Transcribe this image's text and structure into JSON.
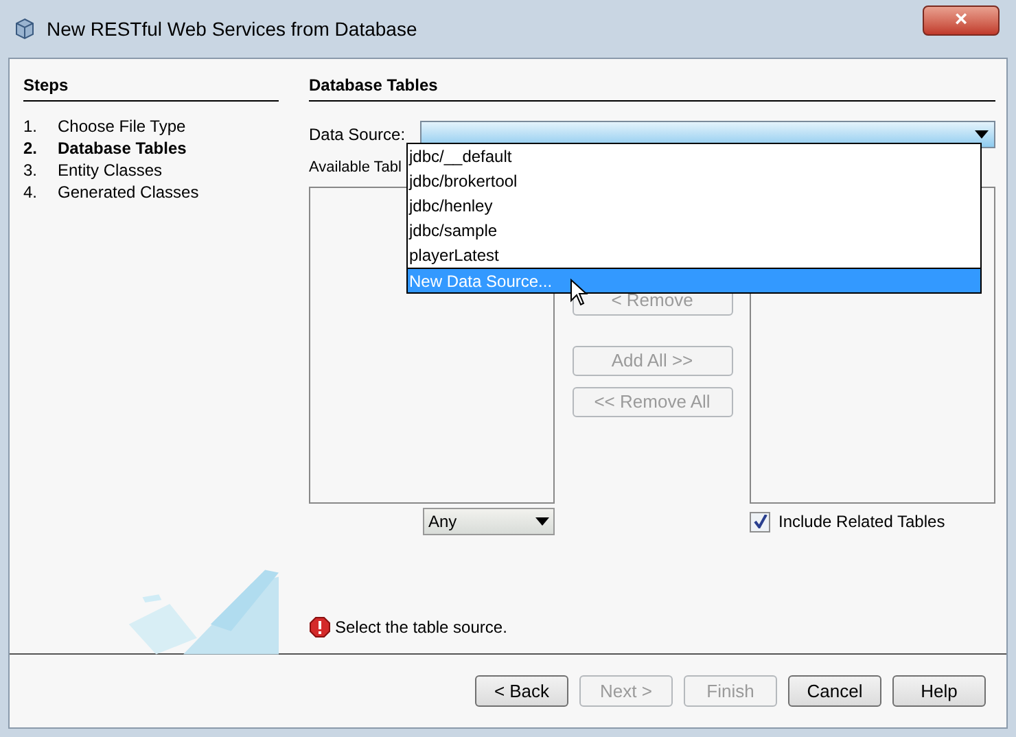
{
  "window": {
    "title": "New RESTful Web Services from Database",
    "close": "×"
  },
  "steps": {
    "title": "Steps",
    "items": [
      {
        "number": "1.",
        "label": "Choose File Type",
        "selected": false
      },
      {
        "number": "2.",
        "label": "Database Tables",
        "selected": true
      },
      {
        "number": "3.",
        "label": "Entity Classes",
        "selected": false
      },
      {
        "number": "4.",
        "label": "Generated Classes",
        "selected": false
      }
    ]
  },
  "panel": {
    "title": "Database Tables",
    "data_source_label": "Data Source:",
    "available_label": "Available Tabl",
    "data_source_options": [
      {
        "label": "jdbc/__default",
        "selected": false
      },
      {
        "label": "jdbc/brokertool",
        "selected": false
      },
      {
        "label": "jdbc/henley",
        "selected": false
      },
      {
        "label": "jdbc/sample",
        "selected": false
      },
      {
        "label": "playerLatest",
        "selected": false
      },
      {
        "label": "New Data Source...",
        "selected": true
      }
    ],
    "middle_buttons": [
      {
        "label": "< Remove",
        "disabled": true
      },
      {
        "label": "Add All >>",
        "disabled": true
      },
      {
        "label": "<< Remove All",
        "disabled": true
      }
    ],
    "filter": {
      "value": "Any"
    },
    "include_related": {
      "label": "Include Related Tables",
      "checked": true
    },
    "message": "Select the table source."
  },
  "buttons": [
    {
      "label": "< Back",
      "disabled": false
    },
    {
      "label": "Next >",
      "disabled": true
    },
    {
      "label": "Finish",
      "disabled": true
    },
    {
      "label": "Cancel",
      "disabled": false
    },
    {
      "label": "Help",
      "disabled": false
    }
  ]
}
